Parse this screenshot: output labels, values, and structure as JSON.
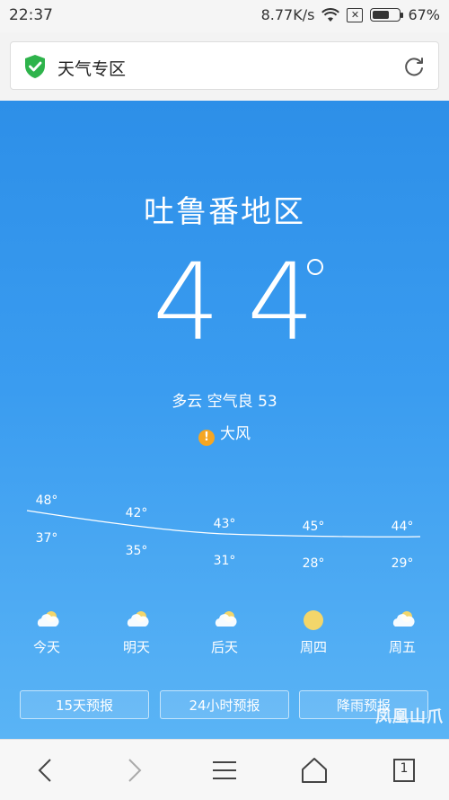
{
  "status": {
    "time": "22:37",
    "speed": "8.77K/s",
    "battery": "67%",
    "battery_level": 0.67
  },
  "urlbar": {
    "title": "天气专区"
  },
  "weather": {
    "city": "吐鲁番地区",
    "temp": "44",
    "condition": "多云  空气良 53",
    "alert": "大风",
    "alert_icon": "!"
  },
  "forecast": [
    {
      "day": "今天",
      "high": "48°",
      "low": "37°",
      "icon": "partly-cloudy-icon"
    },
    {
      "day": "明天",
      "high": "42°",
      "low": "35°",
      "icon": "partly-cloudy-icon"
    },
    {
      "day": "后天",
      "high": "43°",
      "low": "31°",
      "icon": "partly-cloudy-icon"
    },
    {
      "day": "周四",
      "high": "45°",
      "low": "28°",
      "icon": "sun-icon"
    },
    {
      "day": "周五",
      "high": "44°",
      "low": "29°",
      "icon": "partly-cloudy-icon"
    }
  ],
  "buttons": {
    "b1": "15天预报",
    "b2": "24小时预报",
    "b3": "降雨预报"
  },
  "watermark": "凤凰山爪",
  "nav": {
    "tabs": "1"
  }
}
